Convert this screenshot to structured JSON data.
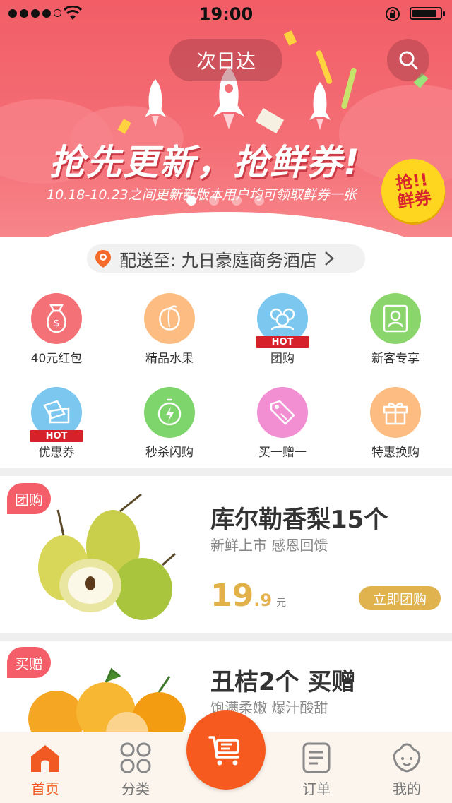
{
  "status": {
    "time": "19:00",
    "battery_level": 0.9
  },
  "banner": {
    "search_label": "次日达",
    "headline": "抢先更新，抢鲜券!",
    "subline": "10.18-10.23之间更新新版本用户均可领取鲜券一张",
    "badge": "抢!!\n鲜券",
    "slides": 4,
    "active_slide": 0
  },
  "address": {
    "text": "配送至: 九日豪庭商务酒店"
  },
  "grid": {
    "items": [
      {
        "label": "40元红包",
        "icon": "money-bag-icon",
        "color": "#f47178",
        "hot": false
      },
      {
        "label": "精品水果",
        "icon": "peach-icon",
        "color": "#fdbd82",
        "hot": false
      },
      {
        "label": "团购",
        "icon": "group-icon",
        "color": "#7cc7ef",
        "hot": true
      },
      {
        "label": "新客专享",
        "icon": "new-user-icon",
        "color": "#8bd66c",
        "hot": false
      },
      {
        "label": "优惠券",
        "icon": "coupon-icon",
        "color": "#7cc7ef",
        "hot": true
      },
      {
        "label": "秒杀闪购",
        "icon": "flash-icon",
        "color": "#7ed56b",
        "hot": false
      },
      {
        "label": "买一赠一",
        "icon": "price-tag-icon",
        "color": "#f28fd2",
        "hot": false
      },
      {
        "label": "特惠换购",
        "icon": "gift-icon",
        "color": "#fdbd82",
        "hot": false
      }
    ],
    "hot_label": "HOT"
  },
  "products": [
    {
      "tag": "团购",
      "title": "库尔勒香梨15个",
      "subtitle": "新鲜上市 感恩回馈",
      "price_int": "19",
      "price_dec": ".9",
      "unit": "元",
      "button": "立即团购"
    },
    {
      "tag": "买赠",
      "title": "丑桔2个 买赠",
      "subtitle": "饱满柔嫩 爆汁酸甜"
    }
  ],
  "tabbar": {
    "tabs": [
      {
        "label": "首页",
        "icon": "home-icon",
        "active": true
      },
      {
        "label": "分类",
        "icon": "category-icon",
        "active": false
      },
      {
        "label": "订单",
        "icon": "order-icon",
        "active": false
      },
      {
        "label": "我的",
        "icon": "profile-icon",
        "active": false
      }
    ],
    "cart_icon": "cart-icon"
  },
  "colors": {
    "accent": "#f65a1f",
    "banner": "#f25d66",
    "price": "#e2b14a"
  }
}
